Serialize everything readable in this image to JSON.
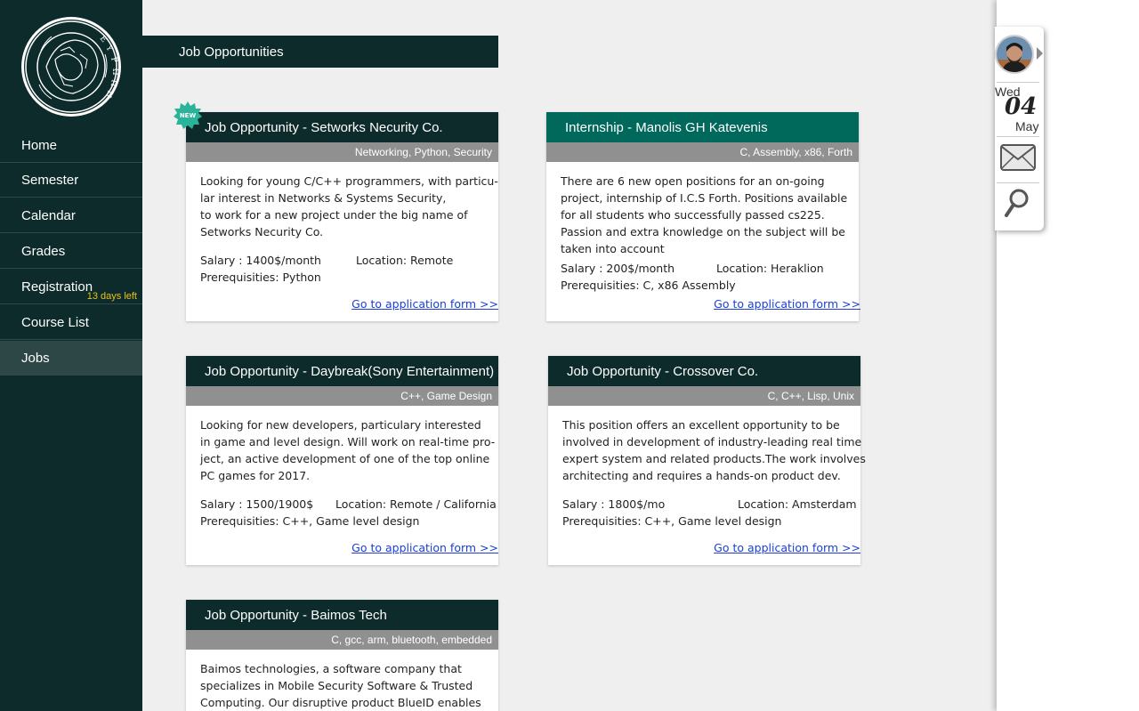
{
  "sidebar": {
    "logo_icon": "university-seal-icon",
    "items": [
      {
        "label": "Home"
      },
      {
        "label": "Semester"
      },
      {
        "label": "Calendar"
      },
      {
        "label": "Grades"
      },
      {
        "label": "Registration",
        "note": "13 days left"
      },
      {
        "label": "Course List"
      },
      {
        "label": "Jobs",
        "active": true
      }
    ]
  },
  "section": {
    "title": "Job Opportunities"
  },
  "badge": {
    "new": "NEW"
  },
  "jobs": [
    {
      "title": "Job Opportunity - Setworks Necurity Co.",
      "tags": "Networking, Python, Security",
      "description": [
        "Looking for young C/C++ programmers, with particu-",
        "lar interest in Networks & Systems Security,",
        "to work for a new project under the big name of",
        "Setworks Necurity Co."
      ],
      "salary": "Salary : 1400$/month",
      "location": "Location: Remote",
      "prerequisites": "Prerequisities: Python",
      "apply": "Go to application form >>"
    },
    {
      "title": "Internship - Manolis GH Katevenis",
      "tags": "C, Assembly, x86, Forth",
      "description": [
        "There are 6 new open positions for an on-going",
        "project, internship of I.C.S Forth. Positions available",
        "for all students who successfully passed cs225.",
        "Passion and extra knowledge on the subject will be",
        "taken into account"
      ],
      "salary": "Salary : 200$/month",
      "location": "Location: Heraklion",
      "prerequisites": "Prerequisities: C, x86 Assembly",
      "apply": "Go to application form >>"
    },
    {
      "title": "Job Opportunity - Daybreak(Sony Entertainment)",
      "tags": "C++, Game Design",
      "description": [
        "Looking for new developers, particulary interested",
        "in game and level design. Will work on real-time pro-",
        "ject, an active development of one of the top online",
        "PC games for 2017."
      ],
      "salary": "Salary : 1500/1900$",
      "location": "Location: Remote / California",
      "prerequisites": "Prerequisities: C++, Game level design",
      "apply": "Go to application form >>"
    },
    {
      "title": "Job Opportunity - Crossover Co.",
      "tags": "C, C++, Lisp, Unix",
      "description": [
        "This position offers an excellent opportunity to be",
        "involved in development of industry-leading real time",
        "expert system and related products.The work involves",
        "architecting and requires a hands-on product dev."
      ],
      "salary": "Salary : 1800$/mo",
      "location": "Location: Amsterdam",
      "prerequisites": "Prerequisities: C++, Game level design",
      "apply": "Go to application form >>"
    },
    {
      "title": "Job Opportunity - Baimos Tech",
      "tags": "C, gcc, arm, bluetooth, embedded",
      "description": [
        "Baimos technologies, a software company that",
        "specializes in Mobile Security Software & Trusted",
        "Computing. Our disruptive product BlueID enables"
      ]
    }
  ],
  "widget": {
    "avatar_icon": "user-avatar-icon",
    "day": "Wed",
    "date": "04",
    "month": "May",
    "mail_icon": "mail-icon",
    "search_icon": "search-icon"
  },
  "colors": {
    "sidebar": "#0e2b2b",
    "header_dark": "#0e2b2b",
    "header_teal": "#00695c",
    "tag_bar": "#909090",
    "link": "#1a3fd6",
    "note": "#e8c21a",
    "badge": "#2bb39a"
  }
}
